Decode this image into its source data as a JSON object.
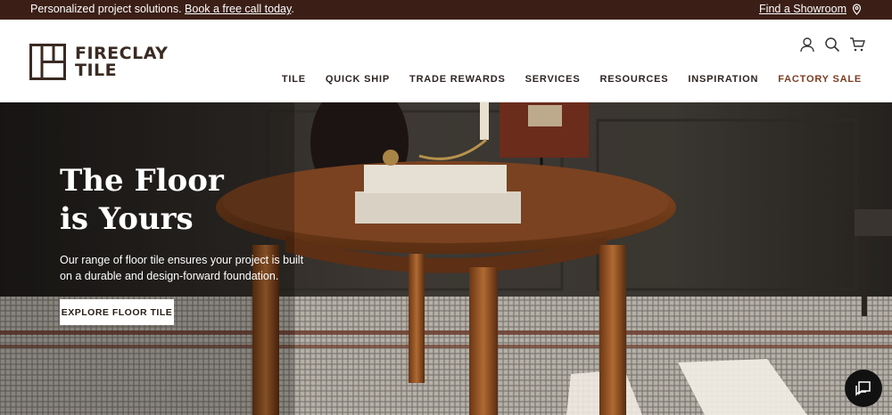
{
  "promo": {
    "text": "Personalized project solutions.",
    "link": "Book a free call today",
    "period": ".",
    "showroom": "Find a Showroom"
  },
  "header": {
    "logo_line1": "FIRECLAY",
    "logo_line2": "TILE",
    "icons": [
      "account-icon",
      "search-icon",
      "cart-icon"
    ]
  },
  "nav": {
    "items": [
      "TILE",
      "QUICK SHIP",
      "TRADE REWARDS",
      "SERVICES",
      "RESOURCES",
      "INSPIRATION",
      "FACTORY SALE"
    ],
    "accent": "#7a3e22"
  },
  "hero": {
    "title": "The Floor is Yours",
    "description": "Our range of floor tile ensures your project is built on a durable and design-forward foundation.",
    "button": "EXPLORE FLOOR TILE"
  },
  "colors": {
    "promo_bg": "#3b1f17",
    "hero_dark": "#2a2623"
  }
}
